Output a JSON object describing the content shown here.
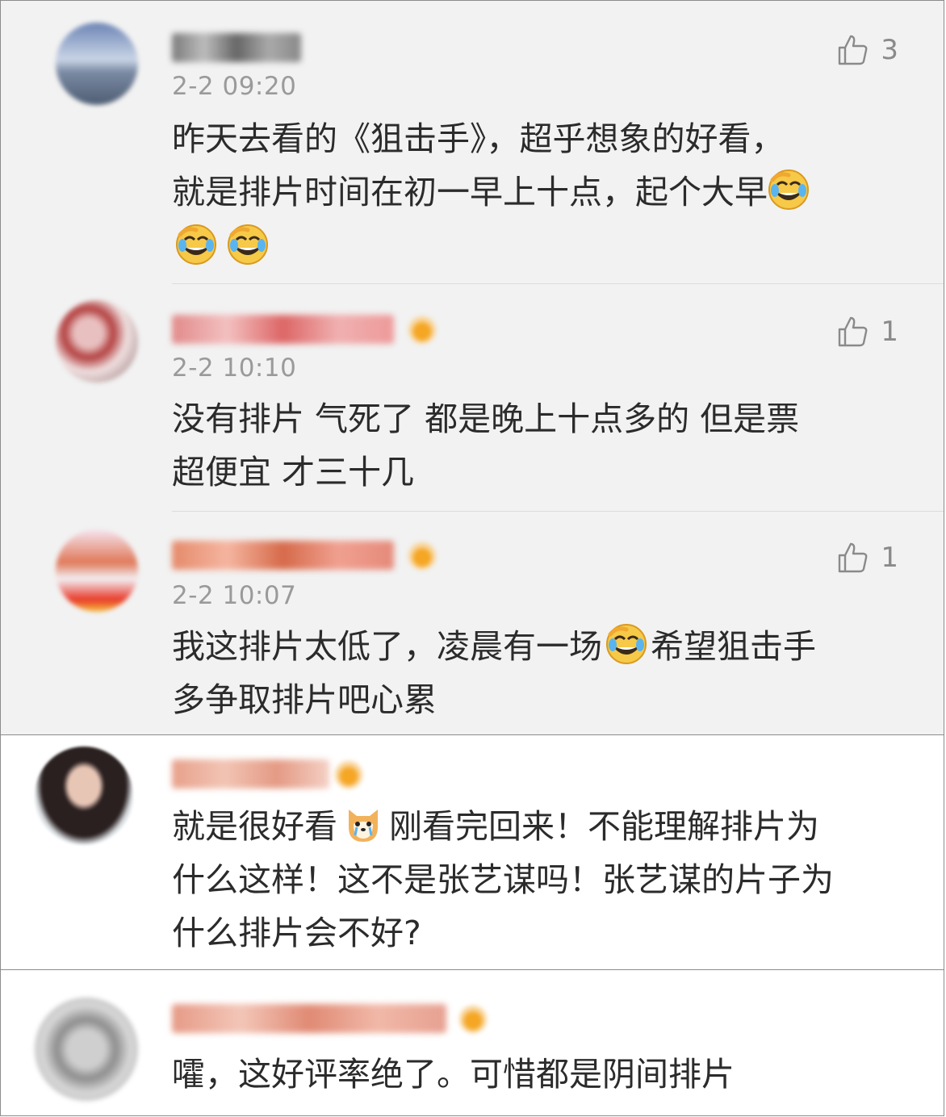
{
  "comments": [
    {
      "time": "2-2 09:20",
      "likes": "3",
      "text_lines": [
        "昨天去看的《狙击手》，超乎想象的好看，",
        "就是排片时间在初一早上十点，起个大早"
      ]
    },
    {
      "time": "2-2 10:10",
      "likes": "1",
      "text_lines": [
        "没有排片 气死了 都是晚上十点多的 但是票",
        "超便宜 才三十几"
      ]
    },
    {
      "time": "2-2 10:07",
      "likes": "1",
      "text_a": "我这排片太低了，凌晨有一场",
      "text_b": "希望狙击手",
      "text_line2": "多争取排片吧心累"
    },
    {
      "text_a": "就是很好看",
      "text_b": "刚看完回来！不能理解排片为",
      "text_lines": [
        "什么这样！这不是张艺谋吗！张艺谋的片子为",
        "什么排片会不好?"
      ]
    },
    {
      "text": "嚯，这好评率绝了。可惜都是阴间排片"
    }
  ],
  "icons": {
    "like": "thumbs-up-icon",
    "laugh_cry": "laugh-cry-emoji",
    "dog": "shiba-dog-emoji",
    "vip": "vip-crown-badge"
  },
  "colors": {
    "group_bg_grey": "#f2f2f2",
    "text": "#2b2b2b",
    "time": "#9a9a9a",
    "like": "#8a8a8a"
  }
}
